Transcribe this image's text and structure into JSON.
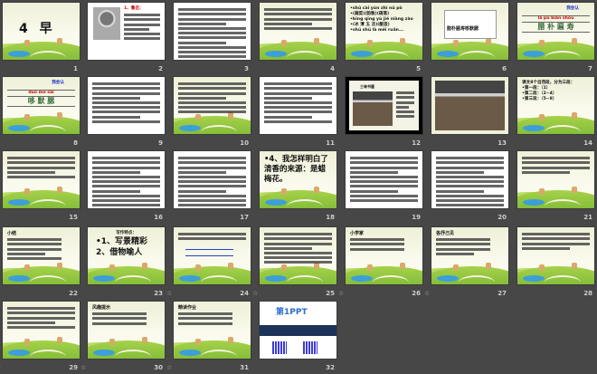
{
  "view": "slide-sorter",
  "slides": [
    {
      "num": "1",
      "bg": "scene",
      "kind": "title",
      "title": "4 早"
    },
    {
      "num": "2",
      "bg": "white",
      "kind": "portrait",
      "title": "1、鲁迅："
    },
    {
      "num": "3",
      "bg": "white",
      "kind": "dense",
      "lines": 12
    },
    {
      "num": "4",
      "bg": "scene",
      "kind": "dense",
      "lines": 5
    },
    {
      "num": "5",
      "bg": "scene",
      "kind": "text",
      "items": [
        "•shū cài  yùn zhì  nǔ pò",
        "•(蔬菜)(韵致)(疏落)",
        "•bīng qīng yù jié niàng zào",
        "•(冰 清 玉 洁)(酿造)",
        "•shū shū là méi ruǎn..."
      ]
    },
    {
      "num": "6",
      "bg": "scene",
      "kind": "box",
      "title": "腊朴匾寿哆默腮"
    },
    {
      "num": "7",
      "bg": "scene",
      "kind": "learn",
      "title": "我会认",
      "pinyin": "là  pǔ  biǎn  shòu",
      "chars": "腊 朴 匾 寿"
    },
    {
      "num": "8",
      "bg": "scene",
      "kind": "learn",
      "title": "我会认",
      "pinyin": "duō  mò  sāi",
      "chars": "哆 默 腮"
    },
    {
      "num": "9",
      "bg": "white",
      "kind": "dense",
      "lines": 9
    },
    {
      "num": "10",
      "bg": "scene",
      "kind": "dense",
      "lines": 7
    },
    {
      "num": "11",
      "bg": "white",
      "kind": "dense",
      "lines": 9
    },
    {
      "num": "12",
      "bg": "photo",
      "kind": "room-framed",
      "title": "三味书屋"
    },
    {
      "num": "13",
      "bg": "photo",
      "kind": "room"
    },
    {
      "num": "14",
      "bg": "scene",
      "kind": "text",
      "items": [
        "课文8个自然段，分为三段：",
        "•第一段：（1）",
        "•第二段：（2~4）",
        "•第三段：（5~8）"
      ]
    },
    {
      "num": "15",
      "bg": "scene",
      "kind": "dense",
      "lines": 5
    },
    {
      "num": "16",
      "bg": "white",
      "kind": "dense",
      "lines": 12
    },
    {
      "num": "17",
      "bg": "white",
      "kind": "dense",
      "lines": 13
    },
    {
      "num": "18",
      "bg": "scene",
      "kind": "text-big",
      "items": [
        "•4、我怎样明白了清香的来源：是蜡梅花。"
      ]
    },
    {
      "num": "19",
      "bg": "white",
      "kind": "dense",
      "lines": 10
    },
    {
      "num": "20",
      "bg": "white",
      "kind": "dense",
      "lines": 12
    },
    {
      "num": "21",
      "bg": "scene",
      "kind": "dense",
      "lines": 4
    },
    {
      "num": "22",
      "bg": "scene",
      "kind": "titled",
      "title": "小结",
      "lines": 5
    },
    {
      "num": "23",
      "bg": "scene",
      "kind": "points",
      "title": "写作特点：",
      "items": [
        "•1、写景精彩",
        "2、借物喻人"
      ]
    },
    {
      "num": "24",
      "bg": "scene",
      "kind": "diagram",
      "anim": true,
      "lines": 3
    },
    {
      "num": "25",
      "bg": "scene",
      "kind": "dense",
      "anim": true,
      "lines": 7
    },
    {
      "num": "26",
      "bg": "scene",
      "kind": "titled",
      "title": "小学家",
      "anim": true,
      "lines": 3
    },
    {
      "num": "27",
      "bg": "scene",
      "kind": "titled",
      "title": "各抒己见",
      "anim": true,
      "lines": 4
    },
    {
      "num": "28",
      "bg": "scene",
      "kind": "dense",
      "lines": 4
    },
    {
      "num": "29",
      "bg": "scene",
      "kind": "dense",
      "anim": true,
      "lines": 5
    },
    {
      "num": "30",
      "bg": "scene",
      "kind": "titled",
      "title": "风趣提示",
      "anim": true,
      "lines": 3
    },
    {
      "num": "31",
      "bg": "scene",
      "kind": "titled",
      "title": "精读作业",
      "anim": true,
      "lines": 3
    },
    {
      "num": "32",
      "bg": "white",
      "kind": "ad",
      "title": "第1PPT"
    }
  ],
  "anim_icon": "transition-star-icon",
  "colors": {
    "background": "#474747",
    "hill": "#8cc63f",
    "pond": "#3c9fd9"
  }
}
